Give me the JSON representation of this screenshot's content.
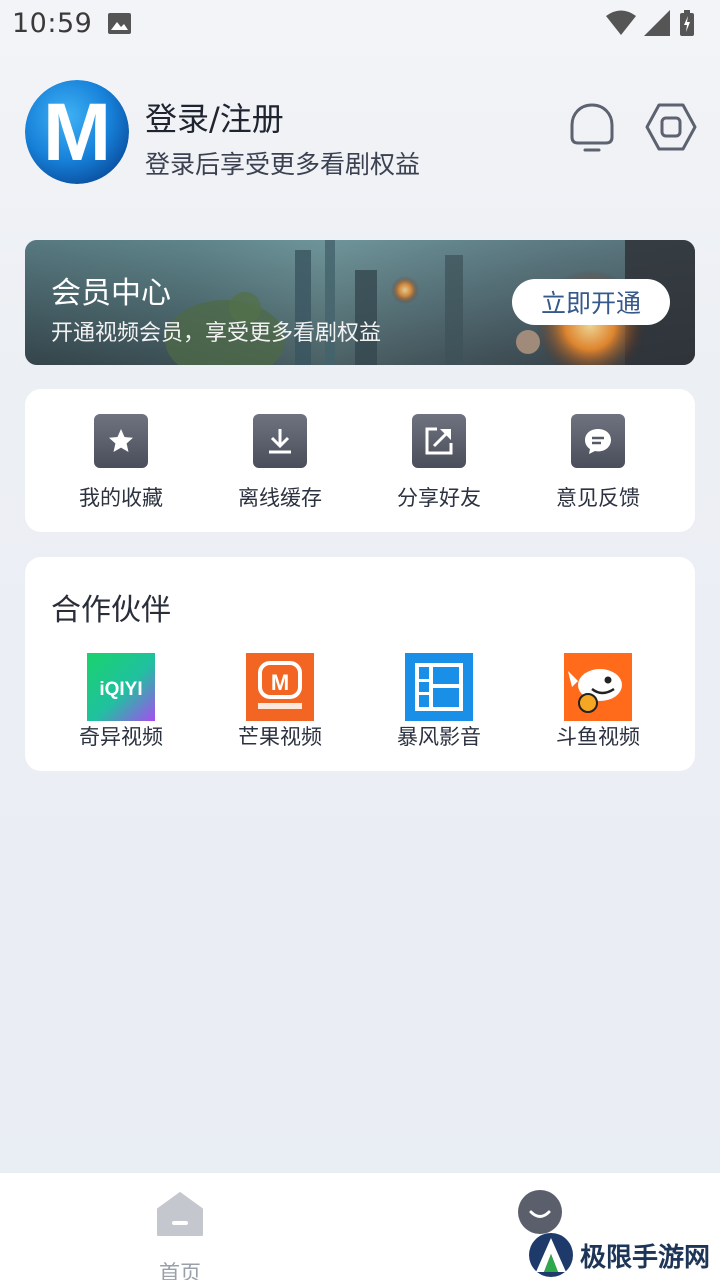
{
  "status_bar": {
    "time": "10:59",
    "icons": [
      "image-icon",
      "wifi-icon",
      "signal-icon",
      "battery-icon"
    ]
  },
  "profile": {
    "avatar_letter": "M",
    "title": "登录/注册",
    "subtitle": "登录后享受更多看剧权益",
    "actions": [
      "notification-bell-icon",
      "settings-hexagon-icon"
    ]
  },
  "vip": {
    "title": "会员中心",
    "subtitle": "开通视频会员，享受更多看剧权益",
    "button": "立即开通"
  },
  "tools": [
    {
      "label": "我的收藏",
      "icon": "star-icon"
    },
    {
      "label": "离线缓存",
      "icon": "download-icon"
    },
    {
      "label": "分享好友",
      "icon": "share-icon"
    },
    {
      "label": "意见反馈",
      "icon": "feedback-icon"
    }
  ],
  "partners": {
    "title": "合作伙伴",
    "items": [
      {
        "label": "奇异视频",
        "logo": "iqiyi-logo",
        "logo_text": "iQIYI"
      },
      {
        "label": "芒果视频",
        "logo": "mango-logo",
        "logo_text": "M"
      },
      {
        "label": "暴风影音",
        "logo": "baofeng-logo"
      },
      {
        "label": "斗鱼视频",
        "logo": "douyu-logo"
      }
    ]
  },
  "bottom_nav": {
    "items": [
      {
        "label": "首页",
        "icon": "home-icon",
        "active": false
      },
      {
        "label": "",
        "icon": "profile-icon",
        "active": true
      }
    ]
  },
  "watermark": {
    "text": "极限手游网"
  },
  "colors": {
    "accent": "#36598c",
    "page_bg": "#eceff4",
    "icon_bg": "#595d69",
    "nav_inactive": "#9aa0aa"
  }
}
